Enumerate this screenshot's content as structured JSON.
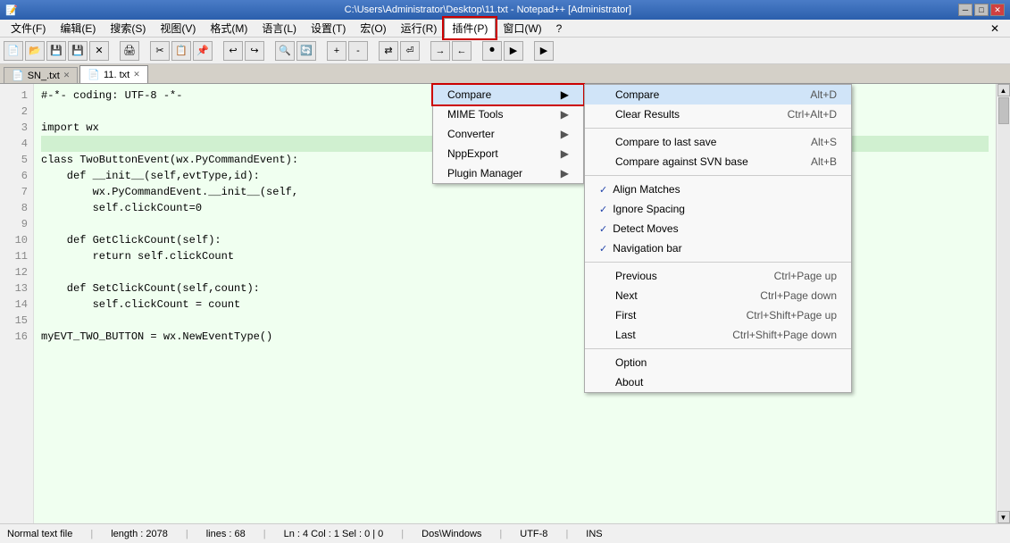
{
  "titlebar": {
    "title": "C:\\Users\\Administrator\\Desktop\\11.txt - Notepad++ [Administrator]",
    "btn_min": "─",
    "btn_max": "□",
    "btn_close": "✕"
  },
  "menubar": {
    "items": [
      {
        "label": "文件(F)"
      },
      {
        "label": "编辑(E)"
      },
      {
        "label": "搜索(S)"
      },
      {
        "label": "视图(V)"
      },
      {
        "label": "格式(M)"
      },
      {
        "label": "语言(L)"
      },
      {
        "label": "设置(T)"
      },
      {
        "label": "宏(O)"
      },
      {
        "label": "运行(R)"
      },
      {
        "label": "插件(P)",
        "active": true
      },
      {
        "label": "窗口(W)"
      },
      {
        "label": "?"
      }
    ],
    "close_x": "✕"
  },
  "tabs": [
    {
      "label": "SN_.txt",
      "active": false
    },
    {
      "label": "11. txt",
      "active": true
    }
  ],
  "code": {
    "lines": [
      {
        "num": 1,
        "text": "#-*- coding: UTF-8 -*-"
      },
      {
        "num": 2,
        "text": ""
      },
      {
        "num": 3,
        "text": "import wx"
      },
      {
        "num": 4,
        "text": ""
      },
      {
        "num": 5,
        "text": "class TwoButtonEvent(wx.PyCommandEvent):"
      },
      {
        "num": 6,
        "text": "    def __init__(self,evtType,id):"
      },
      {
        "num": 7,
        "text": "        wx.PyCommandEvent.__init__(self,"
      },
      {
        "num": 8,
        "text": "        self.clickCount=0"
      },
      {
        "num": 9,
        "text": ""
      },
      {
        "num": 10,
        "text": "    def GetClickCount(self):"
      },
      {
        "num": 11,
        "text": "        return self.clickCount"
      },
      {
        "num": 12,
        "text": ""
      },
      {
        "num": 13,
        "text": "    def SetClickCount(self,count):"
      },
      {
        "num": 14,
        "text": "        self.clickCount = count"
      },
      {
        "num": 15,
        "text": ""
      },
      {
        "num": 16,
        "text": "myEVT_TWO_BUTTON = wx.NewEventType()"
      }
    ]
  },
  "plugins_menu": {
    "items": [
      {
        "label": "Compare",
        "has_arrow": true,
        "highlighted": true
      },
      {
        "label": "MIME Tools",
        "has_arrow": true
      },
      {
        "label": "Converter",
        "has_arrow": true
      },
      {
        "label": "NppExport",
        "has_arrow": true
      },
      {
        "label": "Plugin Manager",
        "has_arrow": true
      }
    ]
  },
  "compare_submenu": {
    "header_label": "Compare",
    "items": [
      {
        "label": "Compare",
        "shortcut": "Alt+D",
        "check": false,
        "highlighted": true
      },
      {
        "label": "Clear Results",
        "shortcut": "Ctrl+Alt+D",
        "check": false
      },
      {
        "sep": true
      },
      {
        "label": "Compare to last save",
        "shortcut": "Alt+S",
        "check": false
      },
      {
        "label": "Compare against SVN base",
        "shortcut": "Alt+B",
        "check": false
      },
      {
        "sep": true
      },
      {
        "label": "Align Matches",
        "shortcut": "",
        "check": true
      },
      {
        "label": "Ignore Spacing",
        "shortcut": "",
        "check": true
      },
      {
        "label": "Detect Moves",
        "shortcut": "",
        "check": true
      },
      {
        "label": "Navigation bar",
        "shortcut": "",
        "check": true
      },
      {
        "sep": true
      },
      {
        "label": "Previous",
        "shortcut": "Ctrl+Page up",
        "check": false
      },
      {
        "label": "Next",
        "shortcut": "Ctrl+Page down",
        "check": false
      },
      {
        "label": "First",
        "shortcut": "Ctrl+Shift+Page up",
        "check": false
      },
      {
        "label": "Last",
        "shortcut": "Ctrl+Shift+Page down",
        "check": false
      },
      {
        "sep": true
      },
      {
        "label": "Option",
        "shortcut": "",
        "check": false
      },
      {
        "label": "About",
        "shortcut": "",
        "check": false
      }
    ]
  },
  "statusbar": {
    "file_type": "Normal text file",
    "length": "length : 2078",
    "lines": "lines : 68",
    "cursor": "Ln : 4   Col : 1   Sel : 0 | 0",
    "line_ending": "Dos\\Windows",
    "encoding": "UTF-8",
    "mode": "INS"
  }
}
